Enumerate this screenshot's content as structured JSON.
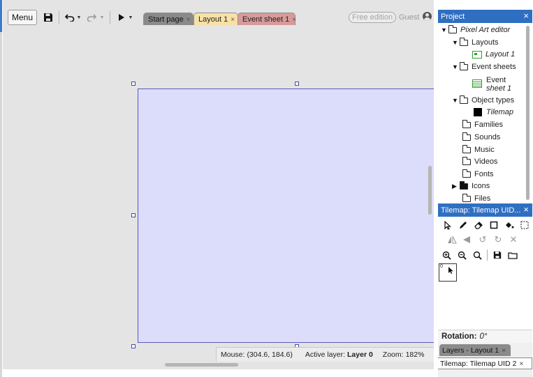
{
  "toolbar": {
    "menu_label": "Menu",
    "save_icon": "save-icon",
    "undo_icon": "undo-icon",
    "redo_icon": "redo-icon",
    "run_icon": "play-icon"
  },
  "tabs": [
    {
      "label": "Start page",
      "close": "×"
    },
    {
      "label": "Layout 1",
      "close": "×"
    },
    {
      "label": "Event sheet 1",
      "close": "×"
    }
  ],
  "account": {
    "edition_badge": "Free edition",
    "user": "Guest"
  },
  "statusbar": {
    "mouse_label": "Mouse:",
    "mouse_value": "(304.6, 184.6)",
    "layer_label": "Active layer:",
    "layer_value": "Layer 0",
    "zoom_label": "Zoom:",
    "zoom_value": "182%"
  },
  "project_panel": {
    "title": "Project",
    "close": "×",
    "tree": {
      "root": "Pixel Art editor",
      "layouts": "Layouts",
      "layout_1": "Layout 1",
      "event_sheets": "Event sheets",
      "event_sheet_line1": "Event",
      "event_sheet_line2": "sheet 1",
      "object_types": "Object types",
      "tilemap": "Tilemap",
      "families": "Families",
      "sounds": "Sounds",
      "music": "Music",
      "videos": "Videos",
      "fonts": "Fonts",
      "icons": "Icons",
      "files": "Files"
    }
  },
  "tilemap_panel": {
    "title": "Tilemap: Tilemap UID...",
    "close": "×",
    "tile_index": "0",
    "rotation_label": "Rotation:",
    "rotation_value": "0°"
  },
  "bottom_tabs": {
    "layers": "Layers - Layout 1",
    "tilemap": "Tilemap: Tilemap UID 2",
    "close": "×"
  },
  "colors": {
    "panel_header": "#2f6fc2",
    "layout_fill": "#dcdcfb",
    "layout_border": "#5a5ab8",
    "tab_layout": "#f8e1a6",
    "tab_event": "#d79a9a"
  }
}
